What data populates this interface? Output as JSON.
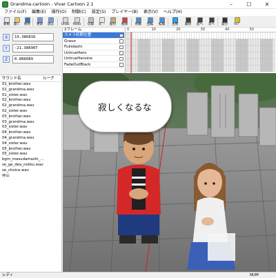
{
  "window": {
    "title": "Grandma.cartoon - Vivar Cartoon 2.1"
  },
  "menu": [
    "ファイル(F)",
    "編集(E)",
    "操作(O)",
    "制御(C)",
    "設定(S)",
    "プレイヤー(B)",
    "表示(V)",
    "ヘルプ(H)"
  ],
  "toolbar": {
    "buttons": [
      {
        "label": "新規",
        "icon": "new-file-icon",
        "color": "#e8e8e8"
      },
      {
        "label": "開く",
        "icon": "open-folder-icon",
        "color": "#e9c46a"
      },
      {
        "label": "保存",
        "icon": "save-icon",
        "color": "#3a6fc4"
      },
      {
        "label": "更新",
        "icon": "refresh-icon",
        "color": "#6ca0dc"
      },
      {
        "label": "読込",
        "icon": "load-icon",
        "color": "#6ca0dc"
      },
      {
        "label": "Undo",
        "icon": "undo-icon",
        "color": "#d9d9d9"
      },
      {
        "label": "Redo",
        "icon": "redo-icon",
        "color": "#d9d9d9"
      },
      {
        "label": "切取",
        "icon": "cut-icon",
        "color": "#c0c0c0"
      },
      {
        "label": "ｺﾋﾟｰ",
        "icon": "copy-icon",
        "color": "#e8e8e8"
      },
      {
        "label": "貼付",
        "icon": "paste-icon",
        "color": "#c9a86a"
      },
      {
        "label": "削除",
        "icon": "delete-icon",
        "color": "#d04040"
      },
      {
        "label": "移動",
        "icon": "move-icon",
        "color": "#4a8fd8"
      },
      {
        "label": "回転",
        "icon": "rotate-icon",
        "color": "#4a8fd8"
      },
      {
        "label": "拡縮",
        "icon": "scale-icon",
        "color": "#4a8fd8"
      },
      {
        "label": "主視",
        "icon": "main-view-icon",
        "color": "#3a9fd8"
      },
      {
        "label": "最初",
        "icon": "first-frame-icon",
        "color": "#404040"
      },
      {
        "label": "前へ",
        "icon": "prev-frame-icon",
        "color": "#404040"
      },
      {
        "label": "次へ",
        "icon": "next-frame-icon",
        "color": "#404040"
      },
      {
        "label": "実行",
        "icon": "run-icon",
        "color": "#303030"
      },
      {
        "label": "ﾍﾙﾌﾟ",
        "icon": "help-icon",
        "color": "#e0c020"
      }
    ]
  },
  "coords": {
    "x": {
      "label": "X",
      "value": "19.386816"
    },
    "y": {
      "label": "Y",
      "value": "-21.386907"
    },
    "z": {
      "label": "Z",
      "value": "0.886089"
    }
  },
  "timeline": {
    "frames_header": "2フレーム",
    "ruler": [
      "0",
      "10",
      "20",
      "30",
      "40",
      "50"
    ],
    "tracks": [
      {
        "name": "カメラ初期位置",
        "selected": true
      },
      {
        "name": "Grave",
        "selected": false
      },
      {
        "name": "Fukidashi",
        "selected": false
      },
      {
        "name": "UntrueHero",
        "selected": false
      },
      {
        "name": "UntrueHeroine",
        "selected": false
      },
      {
        "name": "FadeOutBlack",
        "selected": false
      }
    ]
  },
  "sounds": {
    "col_name": "サウンド名",
    "col_loop": "ループ",
    "items": [
      "01_brother.wav",
      "01_grandma.wav",
      "01_sister.wav",
      "02_brother.wav",
      "02_grandma.wav",
      "02_sister.wav",
      "03_brother.wav",
      "03_grandma.wav",
      "03_sister.wav",
      "04_brother.wav",
      "04_grandma.wav",
      "04_sister.wav",
      "05_brother.wav",
      "05_sister.wav",
      "bgm_masudamashi_...",
      "se_ge_dea_nokku.wav",
      "se_choice.wav",
      "停止"
    ]
  },
  "viewport": {
    "speech": "寂しくなるな"
  },
  "status": {
    "left": "レディ",
    "num": "NUM"
  }
}
